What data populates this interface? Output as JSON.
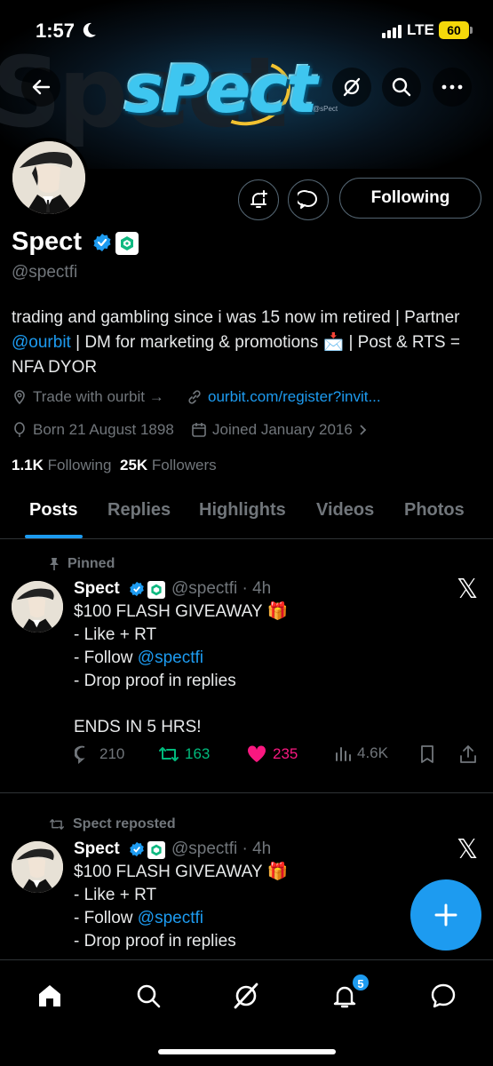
{
  "status_bar": {
    "time": "1:57",
    "network": "LTE",
    "battery": "60"
  },
  "banner": {
    "ghost_text": "Spect",
    "logo_text": "sPect",
    "small_text": "@sPect"
  },
  "profile": {
    "name": "Spect",
    "handle": "@spectfi",
    "follow_label": "Following",
    "bio_pre": "trading and gambling since i was 15 now im retired | Partner ",
    "bio_mention": "@ourbit",
    "bio_post": " | DM for marketing & promotions 📩 | Post & RTS = NFA DYOR",
    "location": "Trade with ourbit →",
    "website": "ourbit.com/register?invit...",
    "born": "Born 21 August 1898",
    "joined": "Joined January 2016",
    "following_count": "1.1K",
    "following_label": "Following",
    "followers_count": "25K",
    "followers_label": "Followers"
  },
  "tabs": [
    "Posts",
    "Replies",
    "Highlights",
    "Videos",
    "Photos"
  ],
  "posts": [
    {
      "context": "Pinned",
      "name": "Spect",
      "handle": "@spectfi · 4h",
      "line1": "$100 FLASH GIVEAWAY 🎁",
      "line2": "- Like + RT",
      "line3_pre": "- Follow ",
      "line3_mention": "@spectfi",
      "line4": "- Drop proof in replies",
      "line5": "ENDS IN 5 HRS!",
      "replies": "210",
      "reposts": "163",
      "likes": "235",
      "views": "4.6K"
    },
    {
      "context": "Spect reposted",
      "name": "Spect",
      "handle": "@spectfi · 4h",
      "line1": "$100 FLASH GIVEAWAY 🎁",
      "line2": "- Like + RT",
      "line3_pre": "- Follow ",
      "line3_mention": "@spectfi",
      "line4": "- Drop proof in replies"
    }
  ],
  "nav": {
    "notification_badge": "5"
  },
  "colors": {
    "accent": "#1d9bf0",
    "repost": "#00ba7c",
    "like": "#f91880",
    "muted": "#71767b"
  }
}
